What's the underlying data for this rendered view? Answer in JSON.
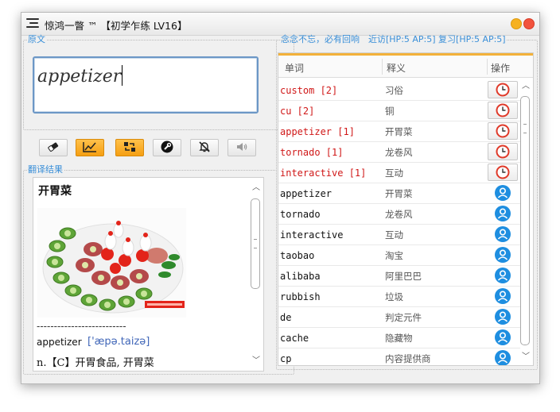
{
  "window": {
    "title": "惊鸿一瞥 ™ 【初学乍练 LV16】"
  },
  "source_panel": {
    "legend": "原文",
    "input_value": "appetizer"
  },
  "toolbar": {
    "buttons": [
      {
        "icon": "eraser-icon",
        "active": false
      },
      {
        "icon": "chart-icon",
        "active": true
      },
      {
        "icon": "shuffle-icon",
        "active": true
      },
      {
        "icon": "wrench-icon",
        "active": false
      },
      {
        "icon": "mute-bell-icon",
        "active": false
      },
      {
        "icon": "speaker-icon",
        "active": false
      }
    ]
  },
  "result_panel": {
    "legend": "翻译结果",
    "title": "开胃菜",
    "dashes": "--------------------------",
    "word": "appetizer",
    "phonetic": "['æpə.taizə]",
    "definition": "n.【C】开胃食品, 开胃菜"
  },
  "word_list": {
    "legend": "念念不忘，必有回响　近访[HP:5 AP:5] 复习[HP:5 AP:5]",
    "headers": {
      "word": "单词",
      "meaning": "释义",
      "action": "操作"
    },
    "rows": [
      {
        "word": "custom [2]",
        "meaning": "习俗",
        "highlight": true,
        "action": "clock-icon"
      },
      {
        "word": "cu [2]",
        "meaning": "铜",
        "highlight": true,
        "action": "clock-icon"
      },
      {
        "word": "appetizer [1]",
        "meaning": "开胃菜",
        "highlight": true,
        "action": "clock-icon"
      },
      {
        "word": "tornado [1]",
        "meaning": "龙卷风",
        "highlight": true,
        "action": "clock-icon"
      },
      {
        "word": "interactive [1]",
        "meaning": "互动",
        "highlight": true,
        "action": "clock-icon"
      },
      {
        "word": "appetizer",
        "meaning": "开胃菜",
        "highlight": false,
        "action": "user-icon"
      },
      {
        "word": "tornado",
        "meaning": "龙卷风",
        "highlight": false,
        "action": "user-icon"
      },
      {
        "word": "interactive",
        "meaning": "互动",
        "highlight": false,
        "action": "user-icon"
      },
      {
        "word": "taobao",
        "meaning": "淘宝",
        "highlight": false,
        "action": "user-icon"
      },
      {
        "word": "alibaba",
        "meaning": "阿里巴巴",
        "highlight": false,
        "action": "user-icon"
      },
      {
        "word": "rubbish",
        "meaning": "垃圾",
        "highlight": false,
        "action": "user-icon"
      },
      {
        "word": "de",
        "meaning": "判定元件",
        "highlight": false,
        "action": "user-icon"
      },
      {
        "word": "cache",
        "meaning": "隐藏物",
        "highlight": false,
        "action": "user-icon"
      },
      {
        "word": "cp",
        "meaning": "内容提供商",
        "highlight": false,
        "action": "user-icon"
      }
    ]
  },
  "colors": {
    "accent_blue": "#3a8fd8",
    "highlight_red": "#d01818",
    "orange_button": "#f59f13",
    "user_icon_blue": "#1e8ee0",
    "clock_red": "#e03a2a"
  }
}
